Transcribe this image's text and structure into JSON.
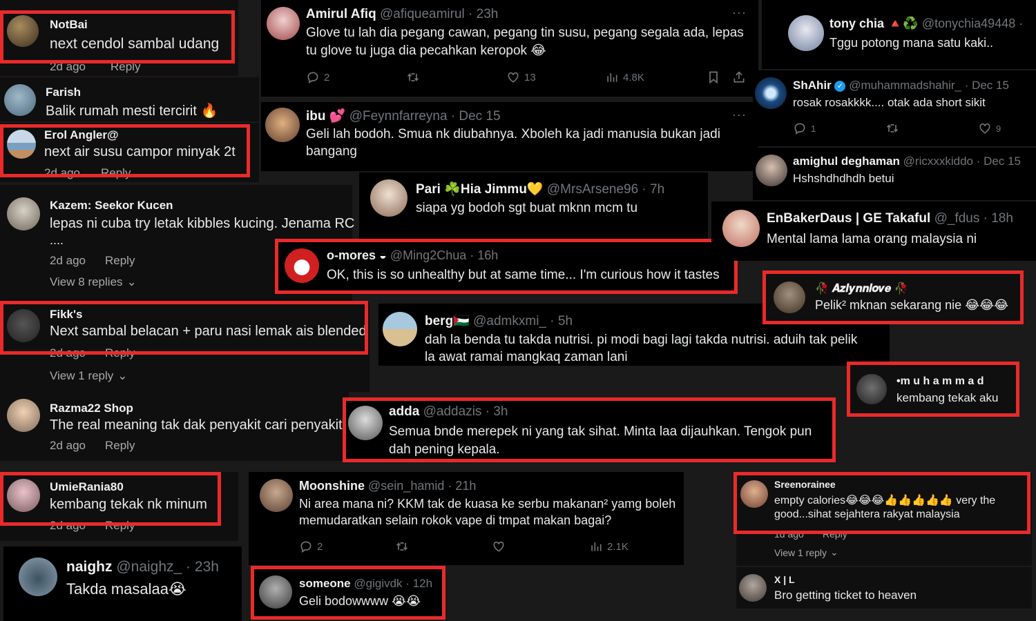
{
  "comments": {
    "notbai": {
      "name": "NotBai",
      "text": "next cendol sambal udang",
      "meta": "2d ago",
      "reply": "Reply"
    },
    "farish": {
      "name": "Farish",
      "text": "Balik rumah mesti tercirit 🔥"
    },
    "erol": {
      "name": "Erol Angler@",
      "text": "next air susu campor minyak 2t",
      "meta": "2d ago",
      "reply": "Reply"
    },
    "kazem": {
      "name": "Kazem: Seekor Kucen",
      "text": "lepas ni cuba try letak kibbles kucing. Jenama RC",
      "text2": "....",
      "meta": "2d ago",
      "reply": "Reply",
      "replies": "View 8 replies"
    },
    "fikk": {
      "name": "Fikk's",
      "text": "Next sambal belacan + paru nasi lemak ais blended",
      "meta": "2d ago",
      "reply": "Reply",
      "replies": "View 1 reply"
    },
    "razma": {
      "name": "Razma22 Shop",
      "text": "The real meaning tak dak penyakit cari penyakit",
      "meta": "2d ago",
      "reply": "Reply"
    },
    "umie": {
      "name": "UmieRania80",
      "text": "kembang tekak nk minum",
      "meta": "2d ago",
      "reply": "Reply"
    },
    "naighz": {
      "name": "naighz",
      "handle": "@naighz_ · 23h",
      "text": "Takda masalaa😭"
    },
    "amirul": {
      "name": "Amirul Afiq",
      "handle": "@afiqueamirul · 23h",
      "text": "Glove tu lah dia pegang cawan, pegang tin susu, pegang segala ada, lepas",
      "text2": "tu glove tu juga dia pecahkan keropok 😂",
      "replies": "2",
      "likes": "13",
      "views": "4.8K"
    },
    "ibu": {
      "name": "ibu 💕",
      "handle": "@Feynnfarreyna · Dec 15",
      "text": "Geli lah bodoh. Smua nk diubahnya. Xboleh ka jadi manusia bukan jadi",
      "text2": "bangang"
    },
    "pari": {
      "name": "Pari ☘️Hia Jimmu💛",
      "handle": "@MrsArsene96 · 7h",
      "text": "siapa yg bodoh sgt buat mknn mcm tu"
    },
    "omores": {
      "name": "o-mores ◒",
      "handle": "@Ming2Chua · 16h",
      "text": "OK, this is so unhealthy but at same time... I'm curious how it tastes"
    },
    "berg": {
      "name": "berg🇵🇸",
      "handle": "@admkxmi_ · 5h",
      "text": "dah la benda tu takda nutrisi. pi modi bagi lagi takda nutrisi. aduih tak pelik",
      "text2": "la awat ramai mangkaq zaman lani"
    },
    "adda": {
      "name": "adda",
      "handle": "@addazis · 3h",
      "text": "Semua bnde merepek ni yang tak sihat. Minta laa dijauhkan. Tengok pun",
      "text2": "dah pening kepala."
    },
    "moonshine": {
      "name": "Moonshine",
      "handle": "@sein_hamid · 21h",
      "text": "Ni area mana ni? KKM tak de kuasa ke serbu makanan² yamg boleh",
      "text2": "memudaratkan selain  rokok vape di tmpat makan bagai?",
      "replies": "2",
      "views": "2.1K"
    },
    "someone": {
      "name": "someone",
      "handle": "@gigivdk · 12h",
      "text": "Geli bodowwww 😭😭"
    },
    "tony": {
      "name": "tony chia 🔺♻️",
      "handle": "@tonychia49448 ·",
      "text": "Tggu potong mana satu kaki.."
    },
    "shahir": {
      "name": "ShAhir",
      "handle": "@muhammadshahir_ · Dec 15",
      "text": "rosak rosakkkk.... otak ada short sikit",
      "replies": "1",
      "likes": "9"
    },
    "amighul": {
      "name": "amighul deghaman",
      "handle": "@ricxxxkiddo · Dec 15",
      "text": "Hshshdhdhdh betui"
    },
    "enbaker": {
      "name": "EnBakerDaus | GE Takaful",
      "handle": "@_fdus · 18h",
      "text": "Mental lama lama orang malaysia ni"
    },
    "azlynn": {
      "name": "🥀 𝑨𝒛𝒍𝒚𝒏𝒏𝒍𝒐𝒗𝒆 🥀",
      "text": "Pelik² mknan sekarang nie 😂😂😂"
    },
    "muhammad": {
      "name": "•m u h a m m a d",
      "text": "kembang tekak aku"
    },
    "sreeno": {
      "name": "Sreenorainee",
      "text": "empty calories😂😂😂👍👍👍👍👍 very the",
      "text2": "good...sihat sejahtera rakyat malaysia",
      "meta": "1d ago",
      "reply": "Reply",
      "replies": "View 1 reply"
    },
    "xl": {
      "name": "X | L",
      "text": "Bro getting ticket to heaven"
    }
  },
  "colors": {
    "highlight": "#ea2a2a",
    "background": "#000000",
    "muted": "#71767b"
  },
  "icons": [
    "reply-icon",
    "retweet-icon",
    "like-icon",
    "views-icon",
    "bookmark-icon",
    "share-icon",
    "more-icon",
    "verified-icon",
    "chevron-down-icon"
  ]
}
